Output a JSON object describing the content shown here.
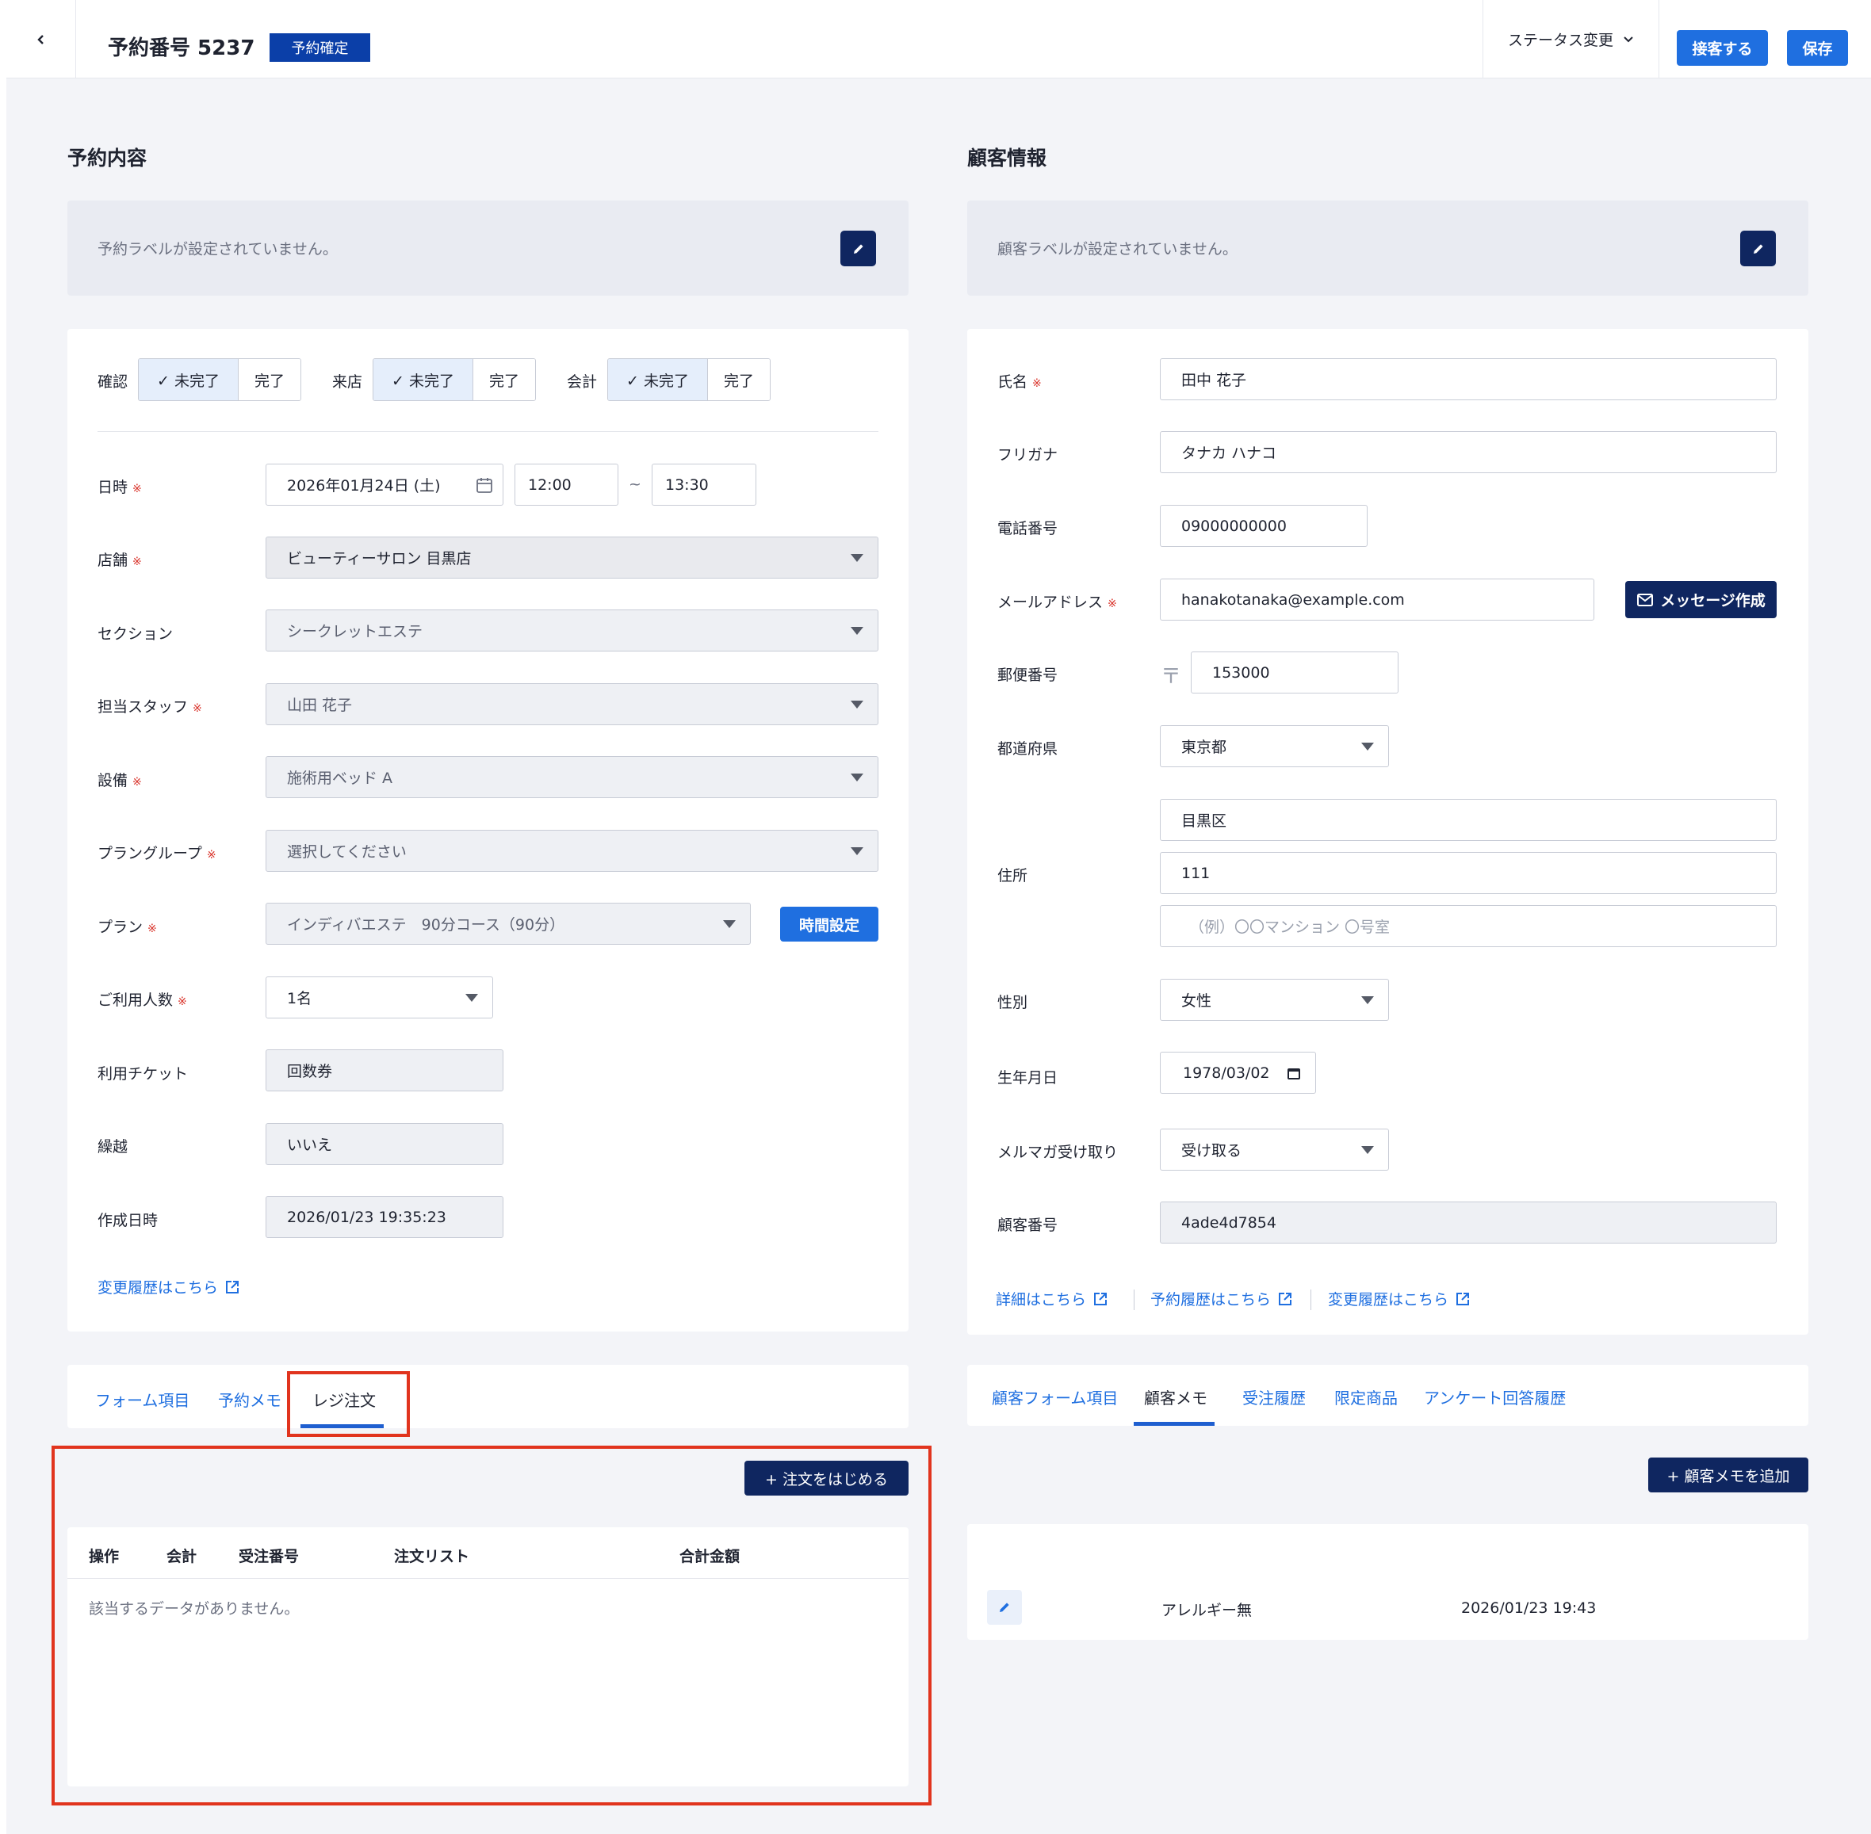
{
  "header": {
    "back_icon": "chevron-left-icon",
    "title": "予約番号 5237",
    "status_badge": "予約確定",
    "status_change": "ステータス変更",
    "receive_button": "接客する",
    "save_button": "保存"
  },
  "reservation": {
    "section_title": "予約内容",
    "label_empty": "予約ラベルが設定されていません。",
    "toggles": [
      {
        "label": "確認",
        "on": "✓ 未完了",
        "off": "完了"
      },
      {
        "label": "来店",
        "on": "✓ 未完了",
        "off": "完了"
      },
      {
        "label": "会計",
        "on": "✓ 未完了",
        "off": "完了"
      }
    ],
    "required_mark": "※",
    "fields": {
      "datetime_label": "日時",
      "date_value": "2026年01月24日 (土)",
      "time_start": "12:00",
      "time_sep": "~",
      "time_end": "13:30",
      "store_label": "店舗",
      "store_value": "ビューティーサロン 目黒店",
      "section_label": "セクション",
      "section_value": "シークレットエステ",
      "staff_label": "担当スタッフ",
      "staff_value": "山田 花子",
      "equipment_label": "設備",
      "equipment_value": "施術用ベッド A",
      "plan_group_label": "プラングループ",
      "plan_group_value": "選択してください",
      "plan_label": "プラン",
      "plan_value": "インディバエステ　90分コース（90分）",
      "time_setting_button": "時間設定",
      "people_label": "ご利用人数",
      "people_value": "1名",
      "ticket_label": "利用チケット",
      "ticket_value": "回数券",
      "carryover_label": "繰越",
      "carryover_value": "いいえ",
      "created_label": "作成日時",
      "created_value": "2026/01/23 19:35:23"
    },
    "history_link": "変更履歴はこちら",
    "tabs": [
      "フォーム項目",
      "予約メモ",
      "レジ注文"
    ],
    "active_tab": 2,
    "start_order_button": "+ 注文をはじめる",
    "table_headers": [
      "操作",
      "会計",
      "受注番号",
      "注文リスト",
      "合計金額"
    ],
    "empty_message": "該当するデータがありません。"
  },
  "customer": {
    "section_title": "顧客情報",
    "label_empty": "顧客ラベルが設定されていません。",
    "fields": {
      "name_label": "氏名",
      "name_value": "田中 花子",
      "kana_label": "フリガナ",
      "kana_value": "タナカ ハナコ",
      "phone_label": "電話番号",
      "phone_value": "09000000000",
      "email_label": "メールアドレス",
      "email_value": "hanakotanaka@example.com",
      "message_button": "メッセージ作成",
      "zip_label": "郵便番号",
      "zip_mark": "〒",
      "zip_value": "153000",
      "pref_label": "都道府県",
      "pref_value": "東京都",
      "address_label": "住所",
      "address1": "目黒区",
      "address2": "111",
      "address3_placeholder": "（例）〇〇マンション 〇号室",
      "gender_label": "性別",
      "gender_value": "女性",
      "birth_label": "生年月日",
      "birth_value": "1978/03/02",
      "newsletter_label": "メルマガ受け取り",
      "newsletter_value": "受け取る",
      "customer_no_label": "顧客番号",
      "customer_no_value": "4ade4d7854"
    },
    "links": [
      "詳細はこちら",
      "予約履歴はこちら",
      "変更履歴はこちら"
    ],
    "tabs": [
      "顧客フォーム項目",
      "顧客メモ",
      "受注履歴",
      "限定商品",
      "アンケート回答履歴"
    ],
    "active_tab": 1,
    "add_memo_button": "+ 顧客メモを追加",
    "memo": {
      "text": "アレルギー無",
      "datetime": "2026/01/23 19:43"
    }
  },
  "colors": {
    "primary": "#1f6fe0",
    "navy": "#0f2660",
    "badge": "#0b3fa8",
    "required": "#d9342b",
    "highlight": "#e1341e"
  }
}
